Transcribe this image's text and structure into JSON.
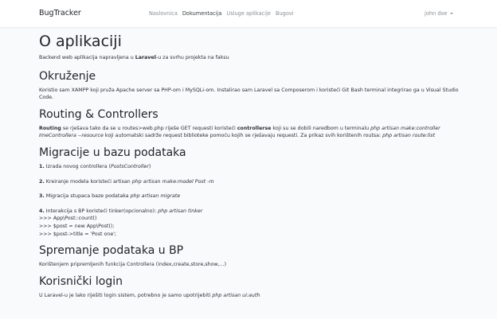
{
  "navbar": {
    "brand": "BugTracker",
    "links": [
      "Naslovnica",
      "Dokumentacija",
      "Usluge aplikacije",
      "Bugovi"
    ],
    "user": "john doe"
  },
  "page": {
    "title": "O aplikaciji",
    "intro": {
      "a": "Backend web aplikacija napravljena u ",
      "b": "Laravel",
      "c": "-u za svrhu projekta na faksu"
    },
    "okruzenje": {
      "heading": "Okruženje",
      "text": "Koristio sam XAMPP koji pruža Apache server sa PHP-om i MySQLi-om. Instalirao sam Laravel sa Composerom i koristeći Git Bash terminal integrirao ga u Visual Studio Code."
    },
    "routing": {
      "heading": "Routing & Controllers",
      "t1": "Routing",
      "t2": " se rješava tako da se u routes>web.php riješe GET requesti koristeći ",
      "t3": "controllerse",
      "t4": " koji su se dobili naredbom u terminalu ",
      "t5": "php artisan make:controller ImeControllera --resource",
      "t6": " koji automatski sadrže request biblioteke pomoću kojih se rješavaju requesti. Za prikaz svih korištenih routsa: ",
      "t7": "php artisan route:list"
    },
    "migracije": {
      "heading": "Migracije u bazu podataka",
      "s1": {
        "num": "1.",
        "text": " Izrada novog controllera (",
        "em": "PostsController",
        "end": ")"
      },
      "s2": {
        "num": "2.",
        "text": " Kreiranje modela koristeći artisan ",
        "em": "php artisan make:model Post -m"
      },
      "s3": {
        "num": "3.",
        "text": " Migracija stupaca baze podataka ",
        "em": "php artisan migrate"
      },
      "s4": {
        "num": "4.",
        "text": " Interakcija s BP koristeći tinker(opcionalno): ",
        "em": "php artisan tinker"
      },
      "code": [
        ">>> App\\Post::count()",
        ">>> $post = new App\\Post();",
        ">>> $post->title = 'Post one';"
      ]
    },
    "spremanje": {
      "heading": "Spremanje podataka u BP",
      "text": "Korištenjem pripremljenih funkcija Controllera (index,create,store,show,...)"
    },
    "login": {
      "heading": "Korisnički login",
      "text": "U Laravel-u je lako riješiti login sistem, potrebno je samo upotrijebiti ",
      "em": "php artisan ui:auth"
    }
  }
}
